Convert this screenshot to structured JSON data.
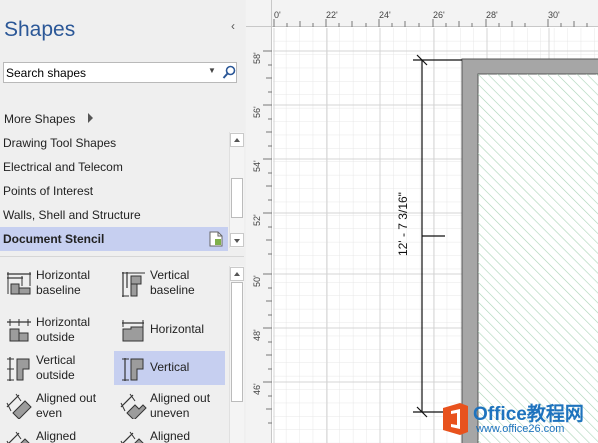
{
  "pane": {
    "title": "Shapes",
    "collapse_glyph": "‹",
    "search": {
      "placeholder": "Search shapes",
      "value": ""
    },
    "more_shapes": "More Shapes",
    "stencils": [
      {
        "label": "Drawing Tool Shapes",
        "active": false
      },
      {
        "label": "Electrical and Telecom",
        "active": false
      },
      {
        "label": "Points of Interest",
        "active": false
      },
      {
        "label": "Walls, Shell and Structure",
        "active": false
      },
      {
        "label": "Document Stencil",
        "active": true
      }
    ],
    "masters": [
      {
        "line1": "Horizontal",
        "line2": "baseline",
        "icon": "horizontal-baseline-icon"
      },
      {
        "line1": "Vertical",
        "line2": "baseline",
        "icon": "vertical-baseline-icon"
      },
      {
        "line1": "Horizontal",
        "line2": "outside",
        "icon": "horizontal-outside-icon"
      },
      {
        "line1": "Horizontal",
        "line2": "",
        "icon": "horizontal-icon"
      },
      {
        "line1": "Vertical",
        "line2": "outside",
        "icon": "vertical-outside-icon"
      },
      {
        "line1": "Vertical",
        "line2": "",
        "icon": "vertical-icon",
        "selected": true
      },
      {
        "line1": "Aligned out",
        "line2": "even",
        "icon": "aligned-out-even-icon"
      },
      {
        "line1": "Aligned out",
        "line2": "uneven",
        "icon": "aligned-out-uneven-icon"
      },
      {
        "line1": "Aligned",
        "line2": "",
        "icon": "aligned-icon"
      },
      {
        "line1": "Aligned",
        "line2": "",
        "icon": "aligned-icon"
      }
    ]
  },
  "ruler": {
    "horizontal": [
      "0'",
      "22'",
      "24'",
      "26'",
      "28'",
      "30'"
    ],
    "vertical": [
      "58'",
      "56'",
      "54'",
      "52'",
      "50'",
      "48'",
      "46'"
    ]
  },
  "drawing": {
    "dimension_label": "12' - 7 3/16\""
  },
  "watermark": {
    "main": "Office教程网",
    "sub": "www.office26.com"
  },
  "colors": {
    "accent": "#2b5797",
    "selection": "#c6cff0",
    "wall": "#a6a6a6",
    "hatch": "#a9d3b6"
  }
}
